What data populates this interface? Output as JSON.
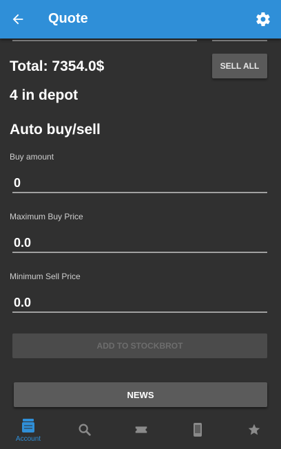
{
  "app_bar": {
    "title": "Quote"
  },
  "position": {
    "total": "Total: 7354.0$",
    "sell_all_label": "SELL ALL",
    "depot": "4 in depot"
  },
  "auto_trade": {
    "heading": "Auto buy/sell",
    "buy_amount": {
      "label": "Buy amount",
      "value": "0"
    },
    "max_buy_price": {
      "label": "Maximum Buy Price",
      "value": "0.0"
    },
    "min_sell_price": {
      "label": "Minimum Sell Price",
      "value": "0.0"
    },
    "add_watchlist_label": "ADD TO STOCKBROT"
  },
  "news_label": "NEWS",
  "bottom_nav": {
    "items": [
      {
        "icon": "wallet-icon",
        "label": "Account",
        "active": true
      },
      {
        "icon": "search-icon",
        "label": "",
        "active": false
      },
      {
        "icon": "ticket-icon",
        "label": "",
        "active": false
      },
      {
        "icon": "phone-icon",
        "label": "",
        "active": false
      },
      {
        "icon": "star-icon",
        "label": "",
        "active": false
      }
    ]
  },
  "colors": {
    "accent": "#2f8fd8",
    "background": "#303030",
    "button": "#5b5b5b"
  }
}
